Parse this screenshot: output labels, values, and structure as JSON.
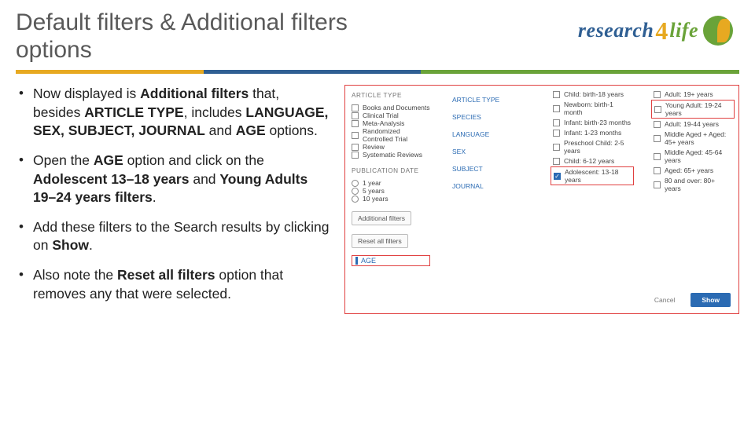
{
  "title": "Default filters & Additional filters options",
  "logo": {
    "p1": "research",
    "p4": "4",
    "p2": "life"
  },
  "bullets": [
    "Now displayed is <b>Additional filters</b> that, besides <b>ARTICLE TYPE</b>, includes <b>LANGUAGE, SEX, SUBJECT, JOURNAL</b> and <b>AGE</b> options.",
    "Open the <b>AGE</b> option and click on the <b>Adolescent 13–18 years</b> and <b>Young Adults 19–24 years filters</b>.",
    "Add these filters to the Search results by clicking on <b>Show</b>.",
    "Also note the <b>Reset all filters</b> option that removes any that were selected."
  ],
  "left": {
    "h_article": "ARTICLE TYPE",
    "articles": [
      "Books and Documents",
      "Clinical Trial",
      "Meta-Analysis",
      "Randomized Controlled Trial",
      "Review",
      "Systematic Reviews"
    ],
    "h_pub": "PUBLICATION DATE",
    "pubs": [
      "1 year",
      "5 years",
      "10 years"
    ],
    "btn_add": "Additional filters",
    "btn_reset": "Reset all filters",
    "age": "AGE"
  },
  "mid": {
    "h_article": "ARTICLE TYPE",
    "h_species": "SPECIES",
    "h_lang": "LANGUAGE",
    "h_sex": "SEX",
    "h_subject": "SUBJECT",
    "h_journal": "JOURNAL"
  },
  "right": {
    "ages": [
      {
        "l": "Child: birth-18 years",
        "c": false,
        "hi": false
      },
      {
        "l": "Newborn: birth-1 month",
        "c": false,
        "hi": false
      },
      {
        "l": "Infant: birth-23 months",
        "c": false,
        "hi": false
      },
      {
        "l": "Infant: 1-23 months",
        "c": false,
        "hi": false
      },
      {
        "l": "Preschool Child: 2-5 years",
        "c": false,
        "hi": false
      },
      {
        "l": "Child: 6-12 years",
        "c": false,
        "hi": false
      },
      {
        "l": "Adolescent: 13-18 years",
        "c": true,
        "hi": true
      }
    ],
    "ages2": [
      {
        "l": "Adult: 19+ years",
        "c": false,
        "hi": false
      },
      {
        "l": "Young Adult: 19-24 years",
        "c": false,
        "hi": true
      },
      {
        "l": "Adult: 19-44 years",
        "c": false,
        "hi": false
      },
      {
        "l": "Middle Aged + Aged: 45+ years",
        "c": false,
        "hi": false
      },
      {
        "l": "Middle Aged: 45-64 years",
        "c": false,
        "hi": false
      },
      {
        "l": "Aged: 65+ years",
        "c": false,
        "hi": false
      },
      {
        "l": "80 and over: 80+ years",
        "c": false,
        "hi": false
      }
    ]
  },
  "footer": {
    "cancel": "Cancel",
    "show": "Show"
  }
}
